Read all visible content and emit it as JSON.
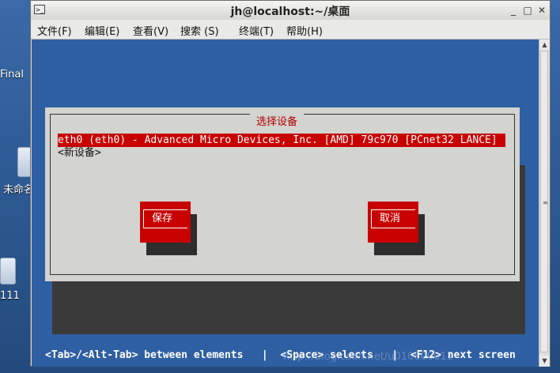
{
  "desktop": {
    "label_final": "Final",
    "label_untitled": "未命名",
    "label_111": "111"
  },
  "window": {
    "title": "jh@localhost:~/桌面",
    "buttons": {
      "minimize": "_",
      "maximize": "□",
      "close": "✕"
    }
  },
  "menubar": {
    "file": "文件(F)",
    "edit": "编辑(E)",
    "view": "查看(V)",
    "search": "搜索 (S)",
    "terminal": "终端(T)",
    "help": "帮助(H)"
  },
  "dialog": {
    "title": "选择设备",
    "devices": [
      "eth0 (eth0) - Advanced Micro Devices, Inc. [AMD] 79c970 [PCnet32 LANCE]",
      "<新设备>"
    ],
    "selected_index": 0,
    "save_label": "保存",
    "cancel_label": "取消"
  },
  "status_bar": "<Tab>/<Alt-Tab> between elements   |  <Space> selects   |  <F12> next screen",
  "watermark": "http://blog.csdn.net/u010800011",
  "colors": {
    "terminal_bg": "#2f5fa3",
    "dialog_bg": "#d3d3cf",
    "accent_red": "#c80000"
  }
}
